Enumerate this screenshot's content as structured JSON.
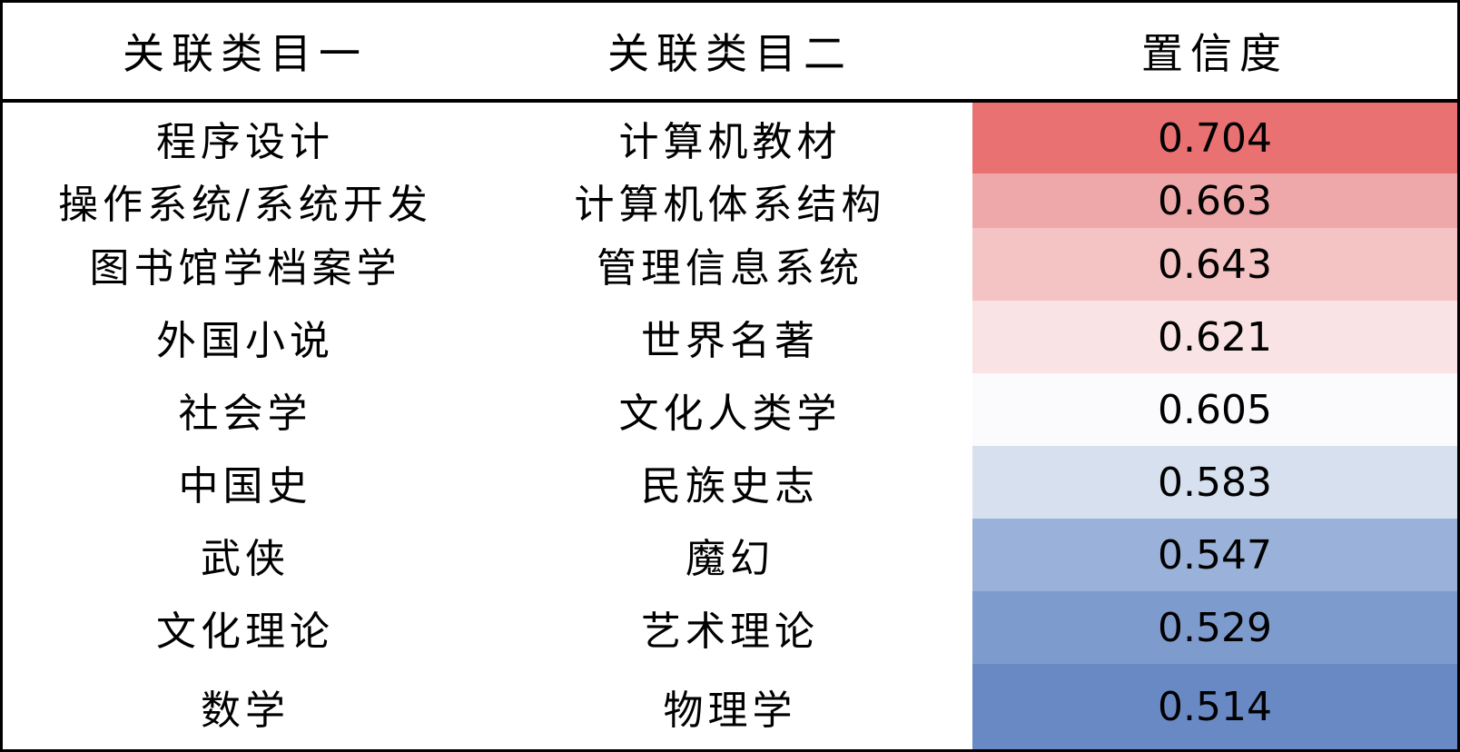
{
  "table": {
    "headers": [
      "关联类目一",
      "关联类目二",
      "置信度"
    ],
    "rows": [
      {
        "cat1": "程序设计",
        "cat2": "计算机教材",
        "confidence": "0.704",
        "color": "#e97171"
      },
      {
        "cat1": "操作系统/系统开发",
        "cat2": "计算机体系结构",
        "confidence": "0.663",
        "color": "#efa8a9"
      },
      {
        "cat1": "图书馆学档案学",
        "cat2": "管理信息系统",
        "confidence": "0.643",
        "color": "#f4c3c4"
      },
      {
        "cat1": "外国小说",
        "cat2": "世界名著",
        "confidence": "0.621",
        "color": "#f9e3e4"
      },
      {
        "cat1": "社会学",
        "cat2": "文化人类学",
        "confidence": "0.605",
        "color": "#fbfafd"
      },
      {
        "cat1": "中国史",
        "cat2": "民族史志",
        "confidence": "0.583",
        "color": "#d6e0ef"
      },
      {
        "cat1": "武侠",
        "cat2": "魔幻",
        "confidence": "0.547",
        "color": "#9ab2d9"
      },
      {
        "cat1": "文化理论",
        "cat2": "艺术理论",
        "confidence": "0.529",
        "color": "#7d9bcd"
      },
      {
        "cat1": "数学",
        "cat2": "物理学",
        "confidence": "0.514",
        "color": "#6889c4"
      }
    ]
  }
}
